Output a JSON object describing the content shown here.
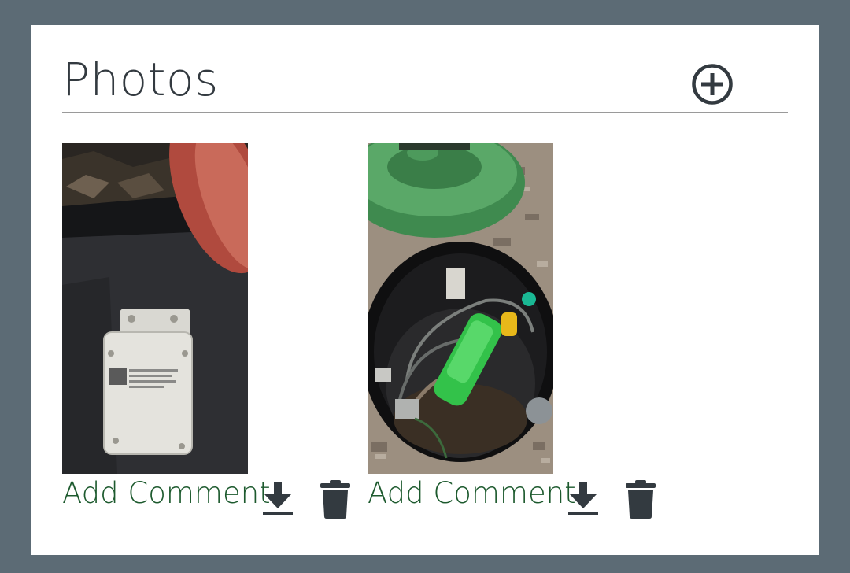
{
  "header": {
    "title": "Photos",
    "add_icon": "plus-circle-icon"
  },
  "photos": [
    {
      "subject": "white sensor box mounted inside dark enclosure",
      "add_comment_label": "Add Comment",
      "download_icon": "download-icon",
      "delete_icon": "trash-icon"
    },
    {
      "subject": "green pump assembly inside black riser basin",
      "add_comment_label": "Add Comment",
      "download_icon": "download-icon",
      "delete_icon": "trash-icon"
    }
  ],
  "colors": {
    "page_background": "#5c6b75",
    "card_background": "#ffffff",
    "title_text": "#333a40",
    "link_green": "#1d5a2e",
    "icon_dark": "#333a40",
    "divider": "#9a9a9a"
  }
}
